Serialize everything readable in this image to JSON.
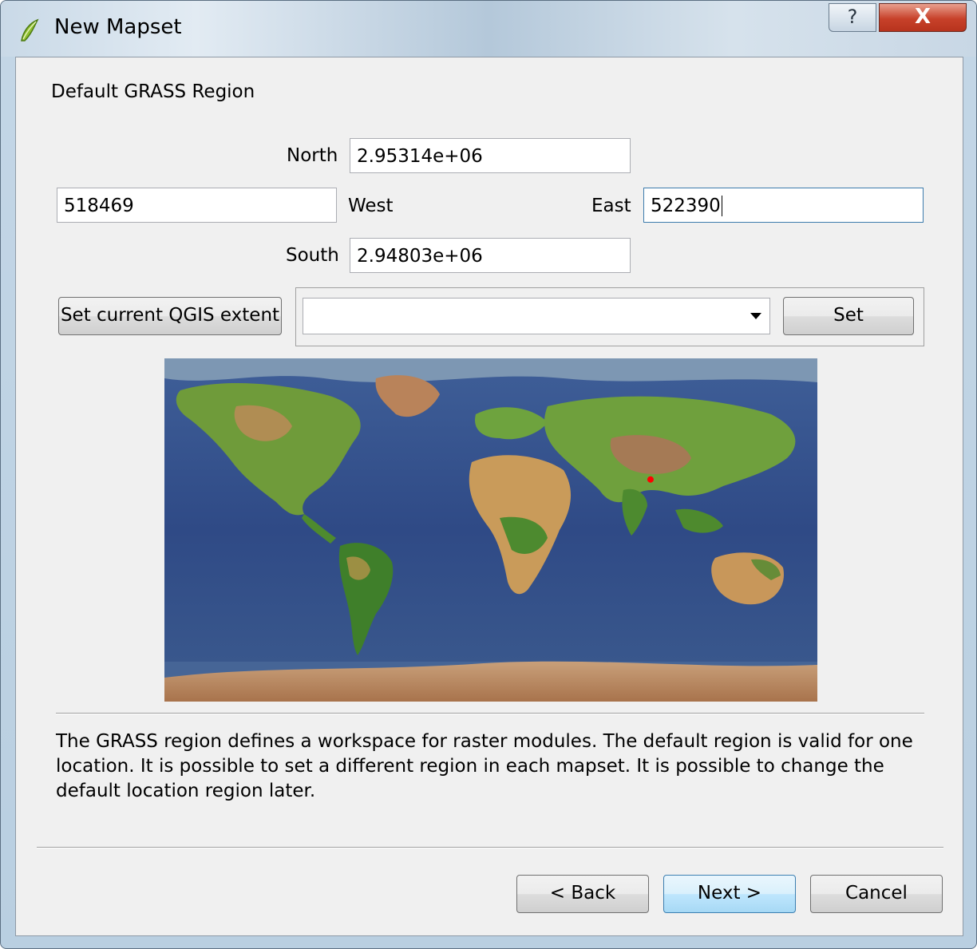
{
  "window": {
    "title": "New Mapset",
    "help_glyph": "?",
    "close_glyph": "X"
  },
  "region": {
    "heading": "Default GRASS Region",
    "north_label": "North",
    "north_value": "2.95314e+06",
    "west_label": "West",
    "west_value": "518469",
    "east_label": "East",
    "east_value": "522390",
    "south_label": "South",
    "south_value": "2.94803e+06",
    "set_current_extent_label": "Set current QGIS extent",
    "combo_value": "",
    "set_label": "Set"
  },
  "map": {
    "icon_name": "world-map-image",
    "marker_color": "#ff0000",
    "marker_lon": 88.0,
    "marker_lat": 26.5
  },
  "description": "The GRASS region defines a workspace for raster modules. The default region is valid for one location. It is possible to set a different region in each mapset. It is possible to change the default location region later.",
  "footer": {
    "back_label": "< Back",
    "next_label": "Next >",
    "cancel_label": "Cancel"
  }
}
